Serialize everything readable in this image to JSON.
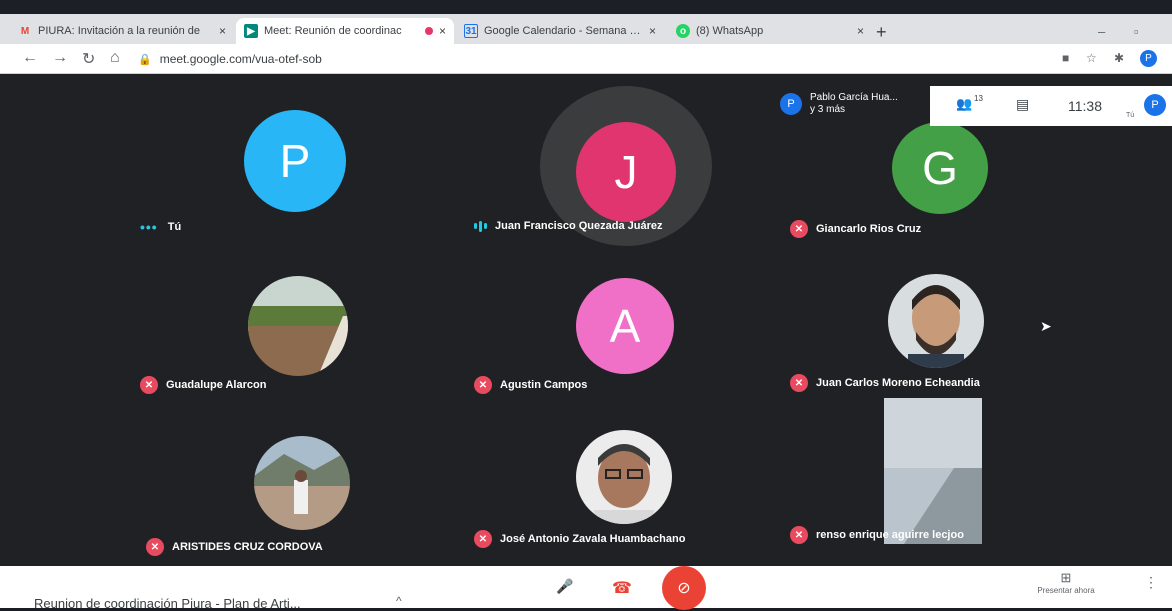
{
  "browser": {
    "tabs": [
      {
        "label": "PIURA: Invitación a la reunión de",
        "icon": "gmail-icon",
        "color": "#ea4335"
      },
      {
        "label": "Meet: Reunión de coordinac",
        "icon": "meet-icon",
        "color": "#00897b",
        "active": true
      },
      {
        "label": "Google Calendario - Semana del",
        "icon": "calendar-icon",
        "color": "#1a73e8"
      },
      {
        "label": "(8) WhatsApp",
        "icon": "whatsapp-icon",
        "color": "#25d366"
      }
    ],
    "close_glyph": "×",
    "new_tab_glyph": "+",
    "url": "meet.google.com/vua-otef-sob",
    "profile_initial": "P"
  },
  "meet": {
    "people_chip": {
      "initial": "P",
      "line1": "Pablo García Hua...",
      "line2": "y 3 más"
    },
    "participant_count": "13",
    "time": "11:38",
    "you_label": "Tú",
    "profile_initial": "P",
    "participants": [
      {
        "name": "Tú",
        "initial": "P",
        "color": "#29b6f6",
        "state": "dots"
      },
      {
        "name": "Juan Francisco Quezada Juárez",
        "initial": "J",
        "color": "#e0356f",
        "state": "speaking"
      },
      {
        "name": "Giancarlo Rios Cruz",
        "initial": "G",
        "color": "#43a047",
        "state": "muted"
      },
      {
        "name": "Guadalupe Alarcon",
        "photo": "river",
        "state": "muted"
      },
      {
        "name": "Agustin Campos",
        "initial": "A",
        "color": "#f06fc7",
        "state": "muted"
      },
      {
        "name": "Juan Carlos Moreno Echeandia",
        "photo": "man-beard",
        "state": "muted"
      },
      {
        "name": "ARISTIDES CRUZ CORDOVA",
        "photo": "outdoor-man",
        "state": "muted"
      },
      {
        "name": "José Antonio Zavala Huambachano",
        "photo": "man-glasses",
        "state": "muted"
      },
      {
        "name": "renso enrique aguirre lecjoo",
        "photo": "ceiling",
        "state": "muted"
      }
    ],
    "meeting_name": "Reunion de coordinación Piura - Plan de Arti...",
    "present_label": "Presentar ahora"
  },
  "colors": {
    "mic_off": "#e84a5f",
    "end_call": "#ea4335",
    "speaking": "#1ecbe1"
  }
}
